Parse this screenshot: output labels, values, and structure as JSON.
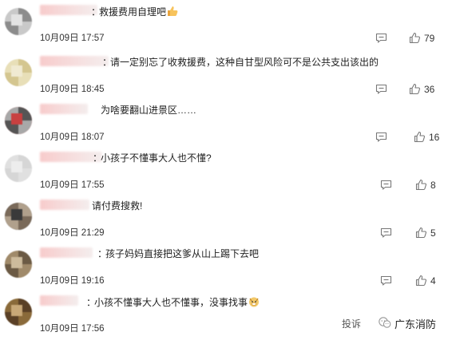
{
  "comments": [
    {
      "text": "救援费用自理吧",
      "has_colon": true,
      "emoji": "thumbs-up-emoji",
      "time": "10月09日 17:57",
      "likes": "79",
      "avatar_colors": [
        "#c9c9c9",
        "#8c8c8c",
        "#e3e3e3"
      ]
    },
    {
      "text": "请一定别忘了收救援费，这种自甘型风险可不是公共支出该出的",
      "has_colon": true,
      "emoji": "",
      "time": "10月09日 18:45",
      "likes": "36",
      "avatar_colors": [
        "#e8dfb8",
        "#d4c690",
        "#f0ead2"
      ]
    },
    {
      "text": "为啥要翻山进景区……",
      "has_colon": false,
      "emoji": "",
      "time": "10月09日 18:07",
      "likes": "16",
      "avatar_colors": [
        "#a8a8a8",
        "#555555",
        "#c84040"
      ]
    },
    {
      "text": "小孩子不懂事大人也不懂?",
      "has_colon": true,
      "emoji": "",
      "time": "10月09日 17:55",
      "likes": "8",
      "avatar_colors": [
        "#e0e0e0",
        "#d6d6d6",
        "#ededed"
      ]
    },
    {
      "text": "请付费搜救!",
      "has_colon": false,
      "emoji": "",
      "time": "10月09日 21:29",
      "likes": "5",
      "avatar_colors": [
        "#7a6a5a",
        "#b0a08c",
        "#3a3a3a"
      ]
    },
    {
      "text": "孩子妈妈直接把这爹从山上踢下去吧",
      "has_colon": true,
      "emoji": "",
      "time": "10月09日 19:16",
      "likes": "4",
      "avatar_colors": [
        "#a08a6a",
        "#6b5a44",
        "#cdbb9c"
      ]
    },
    {
      "text": "小孩不懂事大人也不懂事，没事找事",
      "has_colon": true,
      "emoji": "doge-emoji",
      "time": "10月09日 17:56",
      "likes": "",
      "avatar_colors": [
        "#8a6a3a",
        "#5a4026",
        "#c8a878"
      ]
    }
  ],
  "footer": {
    "report": "投诉",
    "brand": "广东消防",
    "brand_icon": "wechat-account-icon"
  },
  "colors": {
    "text": "#222222",
    "meta": "#333333",
    "icon": "#888888",
    "name_blur": "#f6cfcf"
  }
}
